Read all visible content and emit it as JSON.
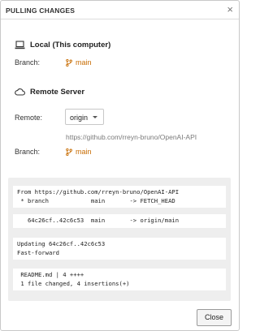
{
  "dialog": {
    "title": "PULLING CHANGES",
    "close_glyph": "×"
  },
  "local": {
    "heading": "Local (This computer)",
    "branch_label": "Branch:",
    "branch_value": "main",
    "icon": "laptop-icon"
  },
  "remote": {
    "heading": "Remote Server",
    "remote_label": "Remote:",
    "remote_value": "origin",
    "url": "https://github.com/rreyn-bruno/OpenAI-API",
    "branch_label": "Branch:",
    "branch_value": "main",
    "icon": "cloud-icon"
  },
  "log": {
    "block1": "From https://github.com/rreyn-bruno/OpenAI-API\n * branch            main       -> FETCH_HEAD",
    "block2": "   64c26cf..42c6c53  main       -> origin/main",
    "block3": "Updating 64c26cf..42c6c53\nFast-forward",
    "block4": " README.md | 4 ++++\n 1 file changed, 4 insertions(+)"
  },
  "footer": {
    "close_label": "Close"
  },
  "colors": {
    "branch": "#c76b00",
    "url": "#7a7a7a"
  }
}
